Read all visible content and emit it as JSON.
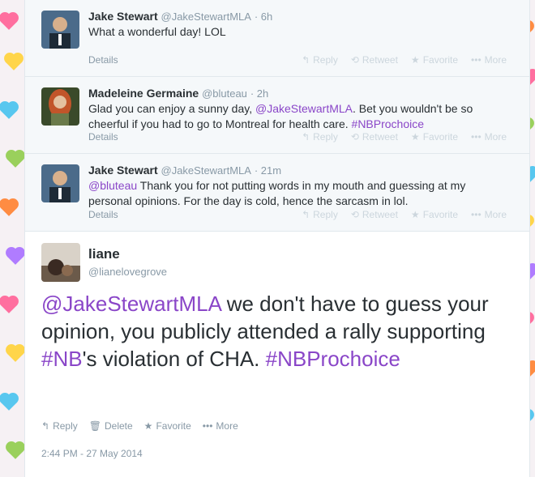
{
  "tweets": [
    {
      "name": "Jake Stewart",
      "handle": "@JakeStewartMLA",
      "time": "· 6h",
      "text_plain": "What a wonderful day! LOL",
      "details": "Details"
    },
    {
      "name": "Madeleine Germaine",
      "handle": "@bluteau",
      "time": "· 2h",
      "text_a": "Glad you can enjoy a sunny day, ",
      "mention": "@JakeStewartMLA",
      "text_b": ". Bet you wouldn't be so cheerful if you had to go to Montreal for health care. ",
      "hashtag": "#NBProchoice",
      "details": "Details"
    },
    {
      "name": "Jake Stewart",
      "handle": "@JakeStewartMLA",
      "time": "· 21m",
      "mention": "@bluteau",
      "text_b": " Thank you for not putting words in my mouth and guessing at my personal opinions. For the day is cold, hence the sarcasm in lol.",
      "details": "Details"
    }
  ],
  "actions_small": {
    "reply": "Reply",
    "retweet": "Retweet",
    "favorite": "Favorite",
    "more": "More"
  },
  "main_tweet": {
    "name": "liane",
    "handle": "@lianelovegrove",
    "mention": "@JakeStewartMLA",
    "text_a": " we don't have to guess your opinion, you publicly attended a rally supporting ",
    "hashtag1": "#NB",
    "text_b": "'s violation of CHA. ",
    "hashtag2": "#NBProchoice",
    "actions": {
      "reply": "Reply",
      "delete": "Delete",
      "favorite": "Favorite",
      "more": "More"
    },
    "timestamp": "2:44 PM - 27 May 2014"
  }
}
